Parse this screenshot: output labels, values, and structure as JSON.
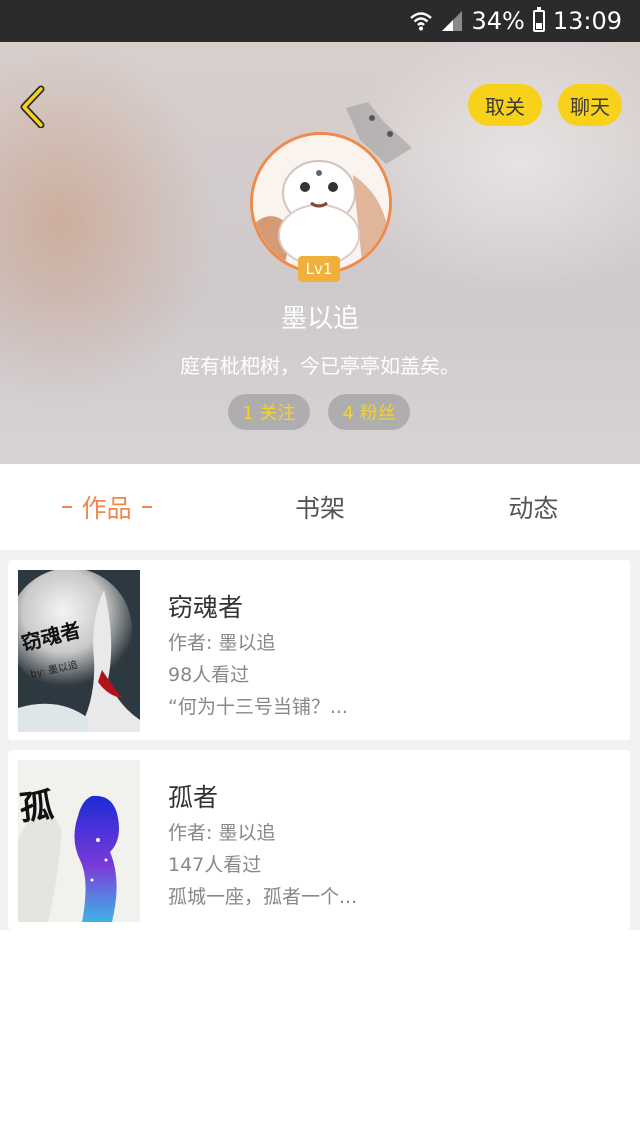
{
  "status_bar": {
    "battery": "34%",
    "time": "13:09",
    "battery_level": 0.34
  },
  "profile": {
    "unfollow_label": "取关",
    "chat_label": "聊天",
    "level": "Lv1",
    "username": "墨以追",
    "bio": "庭有枇杷树，今已亭亭如盖矣。",
    "following": "1 关注",
    "fans": "4 粉丝"
  },
  "tabs": [
    {
      "label": "作品",
      "active": true
    },
    {
      "label": "书架",
      "active": false
    },
    {
      "label": "动态",
      "active": false
    }
  ],
  "works": [
    {
      "title": "窃魂者",
      "author": "作者: 墨以追",
      "views": "98人看过",
      "excerpt": "“何为十三号当铺？...",
      "cover_text": "窃魂者",
      "cover_sub": "by: 墨以追"
    },
    {
      "title": "孤者",
      "author": "作者: 墨以追",
      "views": "147人看过",
      "excerpt": "孤城一座，孤者一个...",
      "cover_text": "孤"
    }
  ],
  "colors": {
    "accent": "#f0874b",
    "yellow": "#f8d21a",
    "chip_text": "#f4d22a"
  }
}
